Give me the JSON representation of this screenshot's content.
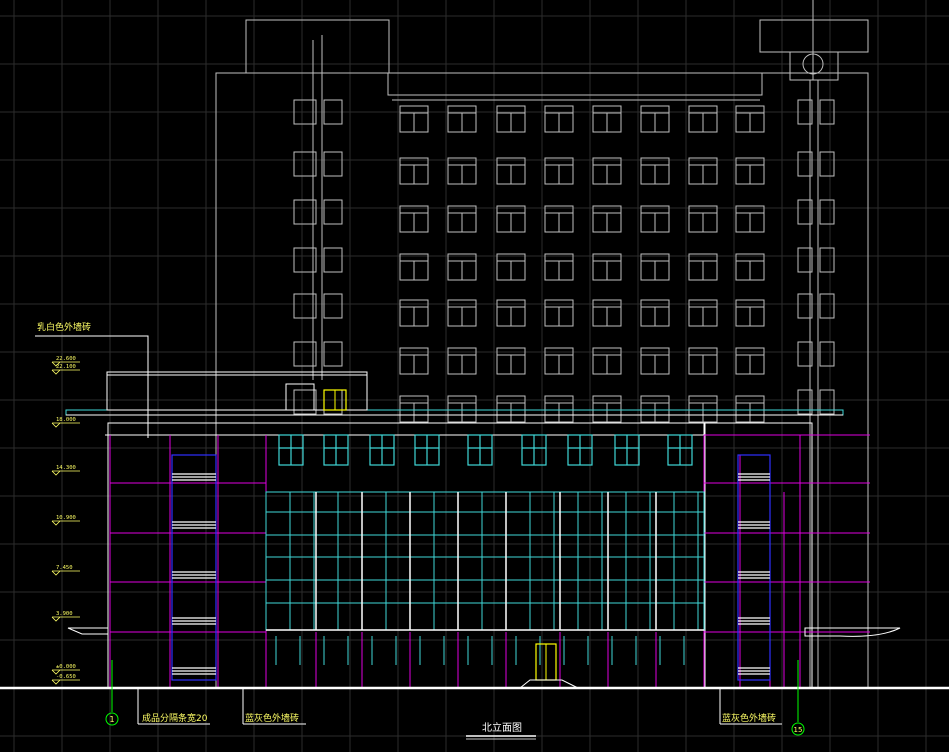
{
  "drawing": {
    "title": "北立面图",
    "annotations": {
      "roof_top": "乳白色外墙砖",
      "bottom_left": "成品分隔条宽20",
      "bottom_mid": "蓝灰色外墙砖",
      "bottom_right": "蓝灰色外墙砖"
    },
    "axes": {
      "left": "1",
      "right": "15"
    },
    "levels": [
      "22.600",
      "22.100",
      "18.000",
      "14.300",
      "10.900",
      "7.450",
      "3.900",
      "±0.000",
      "-0.650"
    ]
  },
  "colors": {
    "background": "#000000",
    "grid": "#2c2c2c",
    "background_building": "#bfbfbf",
    "front_building": "#ffffff",
    "glass": "#3fd7d7",
    "frame": "#e000e0",
    "stair": "#3030ff",
    "accent": "#ffff00",
    "annotation": "#ffff66",
    "axis": "#00ff00"
  }
}
